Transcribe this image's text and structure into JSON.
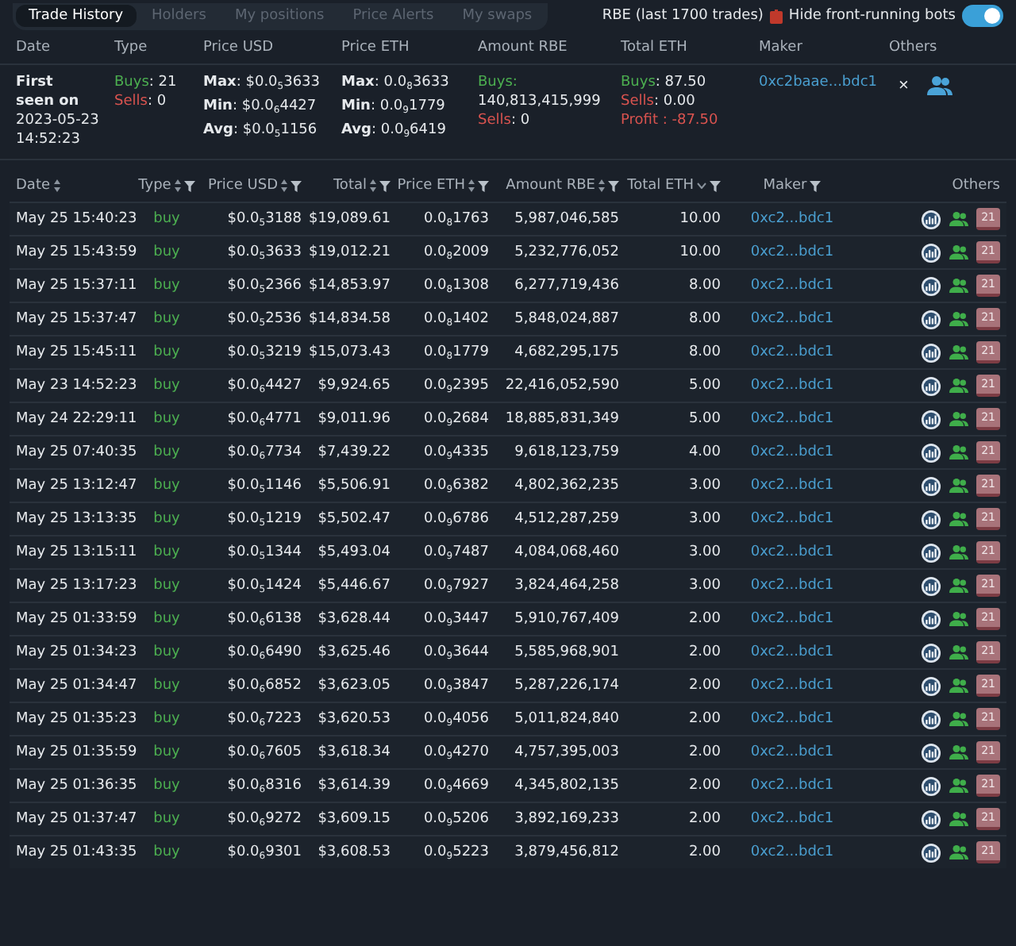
{
  "tabs": [
    {
      "label": "Trade History",
      "selected": true
    },
    {
      "label": "Holders",
      "selected": false
    },
    {
      "label": "My positions",
      "selected": false
    },
    {
      "label": "Price Alerts",
      "selected": false
    },
    {
      "label": "My swaps",
      "selected": false
    }
  ],
  "trades_info": {
    "label": "RBE (last 1700 trades)",
    "filter_label": "Hide front-running bots",
    "filter_on": true
  },
  "summary": {
    "columns": [
      "Date",
      "Type",
      "Price USD",
      "Price ETH",
      "Amount RBE",
      "Total ETH",
      "Maker",
      "Others"
    ],
    "date": {
      "title": "First seen on",
      "value": "2023-05-23 14:52:23"
    },
    "type": [
      {
        "label": "Buys",
        "value": ": 21",
        "color": "#4caf50"
      },
      {
        "label": "Sells",
        "value": ": 0",
        "color": "#d9534f"
      }
    ],
    "price_usd": [
      {
        "label": "Max",
        "value": ": $0.0$_{5}$3633"
      },
      {
        "label": "Min",
        "value": ": $0.0$_{6}$4427"
      },
      {
        "label": "Avg",
        "value": ": $0.0$_{5}$1156"
      }
    ],
    "price_eth": [
      {
        "label": "Max",
        "value": ": 0.0$_{8}$3633"
      },
      {
        "label": "Min",
        "value": ": 0.0$_{9}$1779"
      },
      {
        "label": "Avg",
        "value": ": 0.0$_{9}$6419"
      }
    ],
    "amount": [
      {
        "label": "Buys:",
        "value": "140,813,415,999",
        "color": "#4caf50"
      },
      {
        "label": "Sells",
        "value": ": 0",
        "color": "#d9534f"
      }
    ],
    "total_eth": [
      {
        "label": "Buys",
        "value": ": 87.50",
        "color": "#4caf50"
      },
      {
        "label": "Sells",
        "value": ": 0.00",
        "color": "#d9534f"
      },
      {
        "label": "Profit : -87.50",
        "color": "#d9534f"
      }
    ],
    "maker": "0xc2baae...bdc1",
    "close": "×"
  },
  "table": {
    "columns": [
      {
        "label": "Date",
        "sorted": false,
        "filter": false
      },
      {
        "label": "Type",
        "sorted": false,
        "filter": true
      },
      {
        "label": "Price USD",
        "sorted": false,
        "filter": true
      },
      {
        "label": "Total",
        "sorted": false,
        "filter": true
      },
      {
        "label": "Price ETH",
        "sorted": false,
        "filter": true
      },
      {
        "label": "Amount RBE",
        "sorted": false,
        "filter": true
      },
      {
        "label": "Total ETH",
        "sorted": true,
        "filter": true
      },
      {
        "label": "Maker",
        "filter": true
      },
      {
        "label": "Others"
      }
    ],
    "rows": [
      {
        "date": "May 25 15:40:23",
        "type": "buy",
        "price_usd": "$0.0$_{5}$3188",
        "total": "$19,089.61",
        "price_eth": "0.0$_{8}$1763",
        "amount": "5,987,046,585",
        "total_eth": "10.00",
        "maker": "0xc2...bdc1",
        "badge": "21"
      },
      {
        "date": "May 25 15:43:59",
        "type": "buy",
        "price_usd": "$0.0$_{5}$3633",
        "total": "$19,012.21",
        "price_eth": "0.0$_{8}$2009",
        "amount": "5,232,776,052",
        "total_eth": "10.00",
        "maker": "0xc2...bdc1",
        "badge": "21"
      },
      {
        "date": "May 25 15:37:11",
        "type": "buy",
        "price_usd": "$0.0$_{5}$2366",
        "total": "$14,853.97",
        "price_eth": "0.0$_{8}$1308",
        "amount": "6,277,719,436",
        "total_eth": "8.00",
        "maker": "0xc2...bdc1",
        "badge": "21"
      },
      {
        "date": "May 25 15:37:47",
        "type": "buy",
        "price_usd": "$0.0$_{5}$2536",
        "total": "$14,834.58",
        "price_eth": "0.0$_{8}$1402",
        "amount": "5,848,024,887",
        "total_eth": "8.00",
        "maker": "0xc2...bdc1",
        "badge": "21"
      },
      {
        "date": "May 25 15:45:11",
        "type": "buy",
        "price_usd": "$0.0$_{5}$3219",
        "total": "$15,073.43",
        "price_eth": "0.0$_{8}$1779",
        "amount": "4,682,295,175",
        "total_eth": "8.00",
        "maker": "0xc2...bdc1",
        "badge": "21"
      },
      {
        "date": "May 23 14:52:23",
        "type": "buy",
        "price_usd": "$0.0$_{6}$4427",
        "total": "$9,924.65",
        "price_eth": "0.0$_{9}$2395",
        "amount": "22,416,052,590",
        "total_eth": "5.00",
        "maker": "0xc2...bdc1",
        "badge": "21"
      },
      {
        "date": "May 24 22:29:11",
        "type": "buy",
        "price_usd": "$0.0$_{6}$4771",
        "total": "$9,011.96",
        "price_eth": "0.0$_{9}$2684",
        "amount": "18,885,831,349",
        "total_eth": "5.00",
        "maker": "0xc2...bdc1",
        "badge": "21"
      },
      {
        "date": "May 25 07:40:35",
        "type": "buy",
        "price_usd": "$0.0$_{6}$7734",
        "total": "$7,439.22",
        "price_eth": "0.0$_{9}$4335",
        "amount": "9,618,123,759",
        "total_eth": "4.00",
        "maker": "0xc2...bdc1",
        "badge": "21"
      },
      {
        "date": "May 25 13:12:47",
        "type": "buy",
        "price_usd": "$0.0$_{5}$1146",
        "total": "$5,506.91",
        "price_eth": "0.0$_{9}$6382",
        "amount": "4,802,362,235",
        "total_eth": "3.00",
        "maker": "0xc2...bdc1",
        "badge": "21"
      },
      {
        "date": "May 25 13:13:35",
        "type": "buy",
        "price_usd": "$0.0$_{5}$1219",
        "total": "$5,502.47",
        "price_eth": "0.0$_{9}$6786",
        "amount": "4,512,287,259",
        "total_eth": "3.00",
        "maker": "0xc2...bdc1",
        "badge": "21"
      },
      {
        "date": "May 25 13:15:11",
        "type": "buy",
        "price_usd": "$0.0$_{5}$1344",
        "total": "$5,493.04",
        "price_eth": "0.0$_{9}$7487",
        "amount": "4,084,068,460",
        "total_eth": "3.00",
        "maker": "0xc2...bdc1",
        "badge": "21"
      },
      {
        "date": "May 25 13:17:23",
        "type": "buy",
        "price_usd": "$0.0$_{5}$1424",
        "total": "$5,446.67",
        "price_eth": "0.0$_{9}$7927",
        "amount": "3,824,464,258",
        "total_eth": "3.00",
        "maker": "0xc2...bdc1",
        "badge": "21"
      },
      {
        "date": "May 25 01:33:59",
        "type": "buy",
        "price_usd": "$0.0$_{6}$6138",
        "total": "$3,628.44",
        "price_eth": "0.0$_{9}$3447",
        "amount": "5,910,767,409",
        "total_eth": "2.00",
        "maker": "0xc2...bdc1",
        "badge": "21"
      },
      {
        "date": "May 25 01:34:23",
        "type": "buy",
        "price_usd": "$0.0$_{6}$6490",
        "total": "$3,625.46",
        "price_eth": "0.0$_{9}$3644",
        "amount": "5,585,968,901",
        "total_eth": "2.00",
        "maker": "0xc2...bdc1",
        "badge": "21"
      },
      {
        "date": "May 25 01:34:47",
        "type": "buy",
        "price_usd": "$0.0$_{6}$6852",
        "total": "$3,623.05",
        "price_eth": "0.0$_{9}$3847",
        "amount": "5,287,226,174",
        "total_eth": "2.00",
        "maker": "0xc2...bdc1",
        "badge": "21"
      },
      {
        "date": "May 25 01:35:23",
        "type": "buy",
        "price_usd": "$0.0$_{6}$7223",
        "total": "$3,620.53",
        "price_eth": "0.0$_{9}$4056",
        "amount": "5,011,824,840",
        "total_eth": "2.00",
        "maker": "0xc2...bdc1",
        "badge": "21"
      },
      {
        "date": "May 25 01:35:59",
        "type": "buy",
        "price_usd": "$0.0$_{6}$7605",
        "total": "$3,618.34",
        "price_eth": "0.0$_{9}$4270",
        "amount": "4,757,395,003",
        "total_eth": "2.00",
        "maker": "0xc2...bdc1",
        "badge": "21"
      },
      {
        "date": "May 25 01:36:35",
        "type": "buy",
        "price_usd": "$0.0$_{6}$8316",
        "total": "$3,614.39",
        "price_eth": "0.0$_{9}$4669",
        "amount": "4,345,802,135",
        "total_eth": "2.00",
        "maker": "0xc2...bdc1",
        "badge": "21"
      },
      {
        "date": "May 25 01:37:47",
        "type": "buy",
        "price_usd": "$0.0$_{6}$9272",
        "total": "$3,609.15",
        "price_eth": "0.0$_{9}$5206",
        "amount": "3,892,169,233",
        "total_eth": "2.00",
        "maker": "0xc2...bdc1",
        "badge": "21"
      },
      {
        "date": "May 25 01:43:35",
        "type": "buy",
        "price_usd": "$0.0$_{6}$9301",
        "total": "$3,608.53",
        "price_eth": "0.0$_{9}$5223",
        "amount": "3,879,456,812",
        "total_eth": "2.00",
        "maker": "0xc2...bdc1",
        "badge": "21"
      }
    ]
  }
}
